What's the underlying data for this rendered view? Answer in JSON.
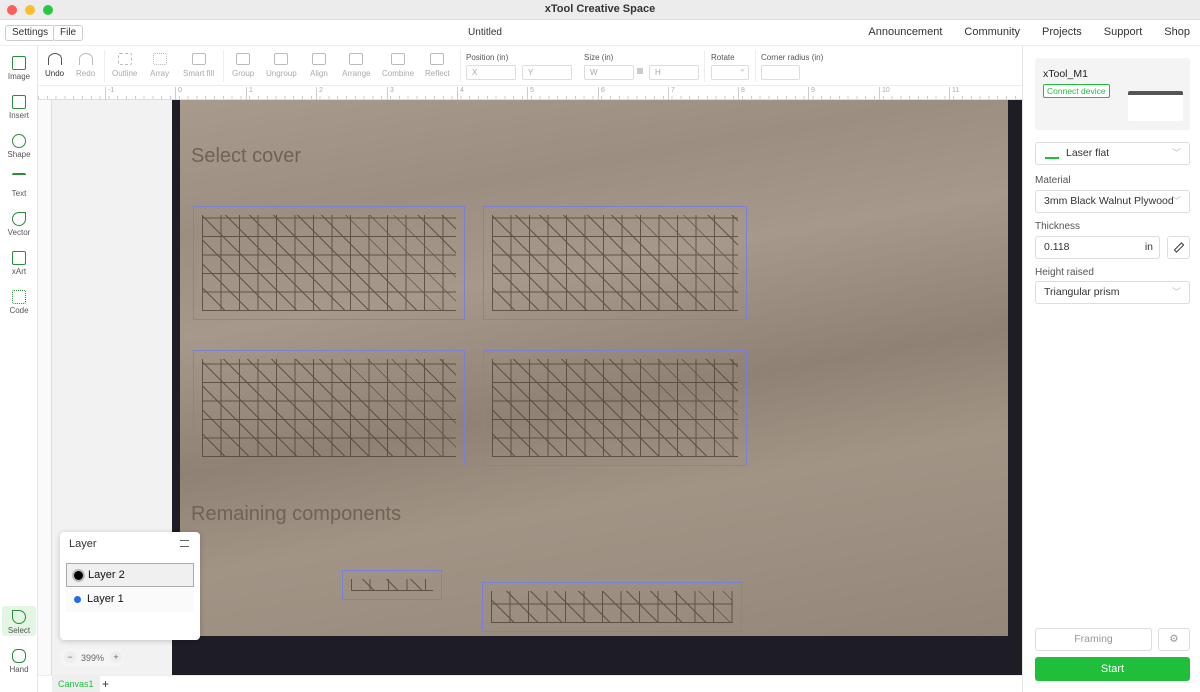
{
  "window": {
    "title": "xTool Creative Space"
  },
  "menubar": {
    "settings": "Settings",
    "file": "File",
    "doc_title": "Untitled",
    "nav": [
      "Announcement",
      "Community",
      "Projects",
      "Support",
      "Shop"
    ]
  },
  "left_tools": [
    {
      "label": "Image",
      "icon": "image-icon"
    },
    {
      "label": "Insert",
      "icon": "insert-icon"
    },
    {
      "label": "Shape",
      "icon": "shape-icon"
    },
    {
      "label": "Text",
      "icon": "text-icon"
    },
    {
      "label": "Vector",
      "icon": "pen-icon"
    },
    {
      "label": "xArt",
      "icon": "ai-icon"
    },
    {
      "label": "Code",
      "icon": "qr-code-icon"
    }
  ],
  "bottom_tools": {
    "select": "Select",
    "hand": "Hand"
  },
  "toolbar": {
    "undo": "Undo",
    "redo": "Redo",
    "outline": "Outline",
    "array": "Array",
    "smart_fill": "Smart fill",
    "group": "Group",
    "ungroup": "Ungroup",
    "align": "Align",
    "arrange": "Arrange",
    "combine": "Combine",
    "reflect": "Reflect",
    "position_label": "Position (in)",
    "x_placeholder": "X",
    "y_placeholder": "Y",
    "size_label": "Size (in)",
    "w_placeholder": "W",
    "h_placeholder": "H",
    "rotate_label": "Rotate",
    "rotate_unit": "°",
    "corner_label": "Corner radius (in)"
  },
  "ruler": [
    "-1",
    "0",
    "1",
    "2",
    "3",
    "4",
    "5",
    "6",
    "7",
    "8",
    "9",
    "10",
    "11"
  ],
  "canvas": {
    "text1": "Select cover",
    "text2": "Remaining components",
    "zoom": "399%",
    "tab": "Canvas1",
    "add_tab": "+"
  },
  "layers": {
    "title": "Layer",
    "items": [
      {
        "name": "Layer 2",
        "color": "#000000",
        "active": true
      },
      {
        "name": "Layer 1",
        "color": "#1e6cf0",
        "active": false
      }
    ]
  },
  "right_panel": {
    "device": "xTool_M1",
    "connect": "Connect device",
    "mode": "Laser flat",
    "material_label": "Material",
    "material": "3mm Black Walnut Plywood",
    "thickness_label": "Thickness",
    "thickness": "0.118",
    "thickness_unit": "in",
    "height_label": "Height raised",
    "height": "Triangular prism",
    "framing": "Framing",
    "start": "Start"
  },
  "colors": {
    "accent": "#1fbe3b",
    "selection": "#7a7fd8"
  }
}
